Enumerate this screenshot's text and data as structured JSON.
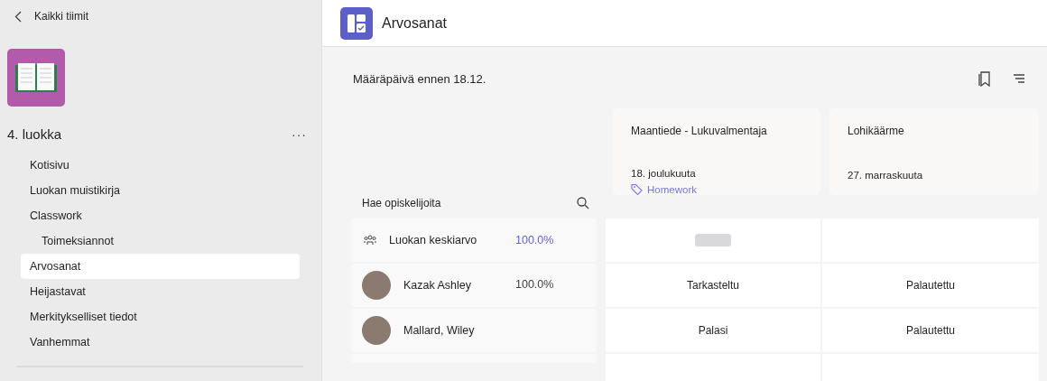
{
  "sidebar": {
    "back_label": "Kaikki tiimit",
    "team_name": "4. luokka",
    "more_label": "···",
    "items": [
      {
        "label": "Kotisivu",
        "selected": false
      },
      {
        "label": "Luokan muistikirja",
        "selected": false
      },
      {
        "label": "Classwork",
        "selected": false,
        "children": [
          {
            "label": "Toimeksiannot",
            "selected": false
          }
        ]
      },
      {
        "label": "Arvosanat",
        "selected": true
      },
      {
        "label": "Heijastavat",
        "selected": false
      },
      {
        "label": "Merkitykselliset tiedot",
        "selected": false
      },
      {
        "label": "Vanhemmat",
        "selected": false
      }
    ]
  },
  "header": {
    "title": "Arvosanat"
  },
  "toolbar": {
    "filter_text": "Määräpäivä ennen 18.12."
  },
  "table": {
    "search_placeholder": "Hae opiskelijoita",
    "assignments": [
      {
        "title": "Maantiede - Lukuvalmentaja",
        "date": "18. joulukuuta",
        "tag": "Homework"
      },
      {
        "title": "Lohikäärme",
        "date": "27. marraskuuta"
      }
    ],
    "rows": [
      {
        "kind": "average",
        "name": "Luokan keskiarvo",
        "percent": "100.0%",
        "cells": [
          {
            "kind": "pending"
          },
          {
            "kind": "empty"
          }
        ]
      },
      {
        "kind": "student",
        "name": "Kazak Ashley",
        "percent": "100.0%",
        "cells": [
          {
            "kind": "text",
            "text": "Tarkasteltu"
          },
          {
            "kind": "text",
            "text": "Palautettu"
          }
        ]
      },
      {
        "kind": "student",
        "name": "Mallard, Wiley",
        "cells": [
          {
            "kind": "text",
            "text": "Palasi"
          },
          {
            "kind": "text",
            "text": "Palautettu"
          }
        ]
      }
    ]
  }
}
